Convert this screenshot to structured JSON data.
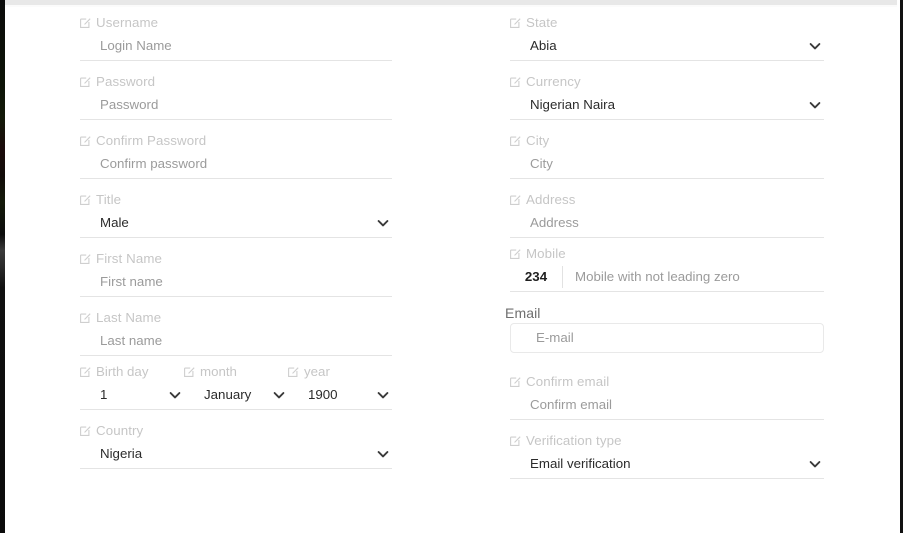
{
  "form": {
    "icon_name": "edit-pencil-icon",
    "chevron_icon_name": "chevron-down-icon",
    "colors": {
      "label": "#c6c6c6",
      "value": "#4a4a4a",
      "placeholder": "#9b9b9b",
      "selected_value": "#2b2b2b",
      "underline": "#e4e4e4",
      "focused_border": "#e9e9e9",
      "background": "#ffffff"
    },
    "left_column": [
      {
        "label": "Username",
        "value": "Login Name",
        "state": "placeholder",
        "type": "text"
      },
      {
        "label": "Password",
        "value": "Password",
        "state": "placeholder",
        "type": "password"
      },
      {
        "label": "Confirm Password",
        "value": "Confirm password",
        "state": "placeholder",
        "type": "password"
      },
      {
        "label": "Title",
        "value": "Male",
        "state": "selected",
        "type": "select"
      },
      {
        "label": "First Name",
        "value": "First name",
        "state": "placeholder",
        "type": "text"
      },
      {
        "label": "Last Name",
        "value": "Last name",
        "state": "placeholder",
        "type": "text"
      }
    ],
    "birth_date": {
      "cells": [
        {
          "label": "Birth day",
          "value": "1",
          "state": "selected",
          "type": "select"
        },
        {
          "label": "month",
          "value": "January",
          "state": "selected",
          "type": "select"
        },
        {
          "label": "year",
          "value": "1900",
          "state": "selected",
          "type": "select"
        }
      ]
    },
    "country": {
      "label": "Country",
      "value": "Nigeria",
      "state": "selected",
      "type": "select"
    },
    "right_column_top": [
      {
        "label": "State",
        "value": "Abia",
        "state": "selected",
        "type": "select"
      },
      {
        "label": "Currency",
        "value": "Nigerian Naira",
        "state": "selected",
        "type": "select"
      },
      {
        "label": "City",
        "value": "City",
        "state": "placeholder",
        "type": "text"
      },
      {
        "label": "Address",
        "value": "Address",
        "state": "placeholder",
        "type": "text"
      }
    ],
    "mobile": {
      "label": "Mobile",
      "country_code": "234",
      "placeholder": "Mobile with not leading zero"
    },
    "email": {
      "label": "Email",
      "placeholder": "E-mail"
    },
    "right_column_bottom": [
      {
        "label": "Confirm email",
        "value": "Confirm email",
        "state": "placeholder",
        "type": "text"
      },
      {
        "label": "Verification type",
        "value": "Email verification",
        "state": "selected",
        "type": "select"
      }
    ]
  }
}
